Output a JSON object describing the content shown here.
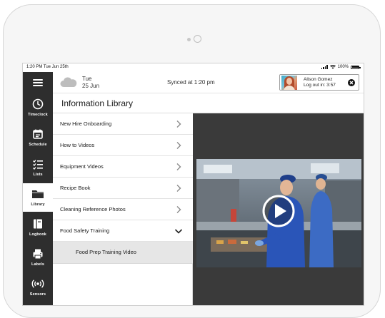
{
  "status_bar": {
    "time_date": "1:20 PM Tue Jun 25th",
    "battery": "100%"
  },
  "header": {
    "day": "Tue",
    "date": "25 Jun",
    "sync_status": "Synced at 1:20 pm",
    "user_name": "Alison Gomez",
    "logout_text": "Log out in: 3:57"
  },
  "sidebar": {
    "items": [
      {
        "label": "Timeclock",
        "icon": "clock-icon"
      },
      {
        "label": "Schedule",
        "icon": "calendar-icon"
      },
      {
        "label": "Lists",
        "icon": "checklist-icon"
      },
      {
        "label": "Library",
        "icon": "folder-icon",
        "active": true
      },
      {
        "label": "Logbook",
        "icon": "book-icon"
      },
      {
        "label": "Labels",
        "icon": "printer-icon"
      },
      {
        "label": "Sensors",
        "icon": "sensor-icon"
      }
    ]
  },
  "library": {
    "title": "Information Library",
    "items": [
      {
        "label": "New Hire Onboarding",
        "state": "collapsed"
      },
      {
        "label": "How to Videos",
        "state": "collapsed"
      },
      {
        "label": "Equipment Videos",
        "state": "collapsed"
      },
      {
        "label": "Recipe Book",
        "state": "collapsed"
      },
      {
        "label": "Cleaning Reference Photos",
        "state": "collapsed"
      },
      {
        "label": "Food Safety Training",
        "state": "expanded"
      }
    ],
    "sub_items": [
      {
        "label": "Food Prep Training Video",
        "selected": true
      }
    ]
  },
  "colors": {
    "sidebar_bg": "#2e2e2e",
    "content_bg": "#3a3a3a",
    "selected_row_bg": "#e6e6e6"
  }
}
